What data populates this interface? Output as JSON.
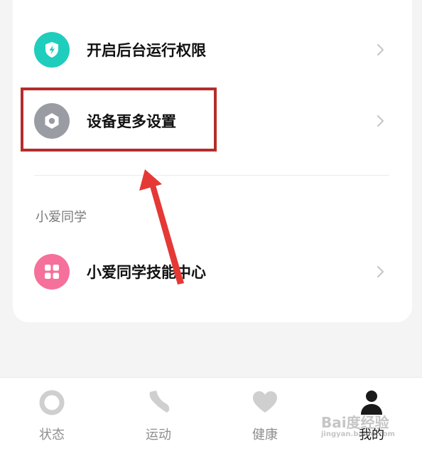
{
  "settings": {
    "items": [
      {
        "label": "开启后台运行权限",
        "icon": "shield-bolt-icon",
        "icon_color": "#1fcdbd"
      },
      {
        "label": "设备更多设置",
        "icon": "hex-nut-icon",
        "icon_color": "#9a9ca3"
      }
    ]
  },
  "xiaoai": {
    "section_title": "小爱同学",
    "items": [
      {
        "label": "小爱同学技能中心",
        "icon": "grid-apps-icon",
        "icon_color": "#f5709a"
      }
    ]
  },
  "annotation": {
    "highlight_color": "#b32d2a",
    "arrow_color": "#e53935"
  },
  "tabbar": {
    "tabs": [
      {
        "label": "状态",
        "icon": "ring-icon",
        "active": false
      },
      {
        "label": "运动",
        "icon": "shoe-icon",
        "active": false
      },
      {
        "label": "健康",
        "icon": "heart-icon",
        "active": false
      },
      {
        "label": "我的",
        "icon": "person-icon",
        "active": true
      }
    ]
  },
  "watermark": {
    "text": "Bai度经验",
    "subtext": "jingyan.baidu.com"
  }
}
